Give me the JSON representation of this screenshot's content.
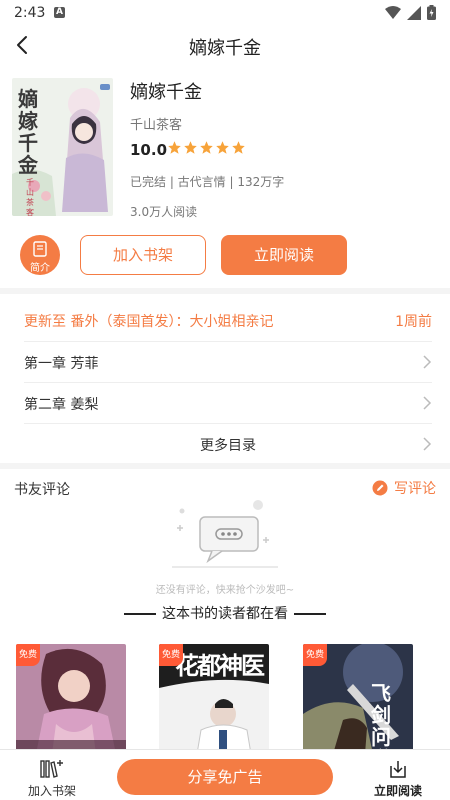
{
  "status_bar": {
    "time": "2:43",
    "notif_letter": "A"
  },
  "header": {
    "title": "嫡嫁千金"
  },
  "book": {
    "title": "嫡嫁千金",
    "author": "千山茶客",
    "score": "10.0",
    "stars": 5,
    "meta": "已完结 | 古代言情 | 132万字",
    "reads": "3.0万人阅读",
    "cover_title": "嫡嫁千金",
    "cover_author": "千山茶客"
  },
  "actions": {
    "intro_label": "简介",
    "add_shelf": "加入书架",
    "read_now": "立即阅读"
  },
  "chapters": {
    "update_text": "更新至 番外（泰国首发）：大小姐相亲记",
    "update_time": "1周前",
    "items": [
      "第一章 芳菲",
      "第二章 姜梨"
    ],
    "more": "更多目录"
  },
  "reviews": {
    "title": "书友评论",
    "write": "写评论",
    "empty": "还没有评论，快来抢个沙发吧~"
  },
  "recommend": {
    "title": "这本书的读者都在看",
    "free_tag": "免费",
    "books": [
      {
        "cover_text": ""
      },
      {
        "cover_text": "花都神医"
      },
      {
        "cover_text": "飞剑问道"
      }
    ]
  },
  "bottom_bar": {
    "add_shelf": "加入书架",
    "share": "分享免广告",
    "read_now": "立即阅读"
  },
  "colors": {
    "accent": "#f47c44",
    "free_tag": "#ff5a36"
  }
}
